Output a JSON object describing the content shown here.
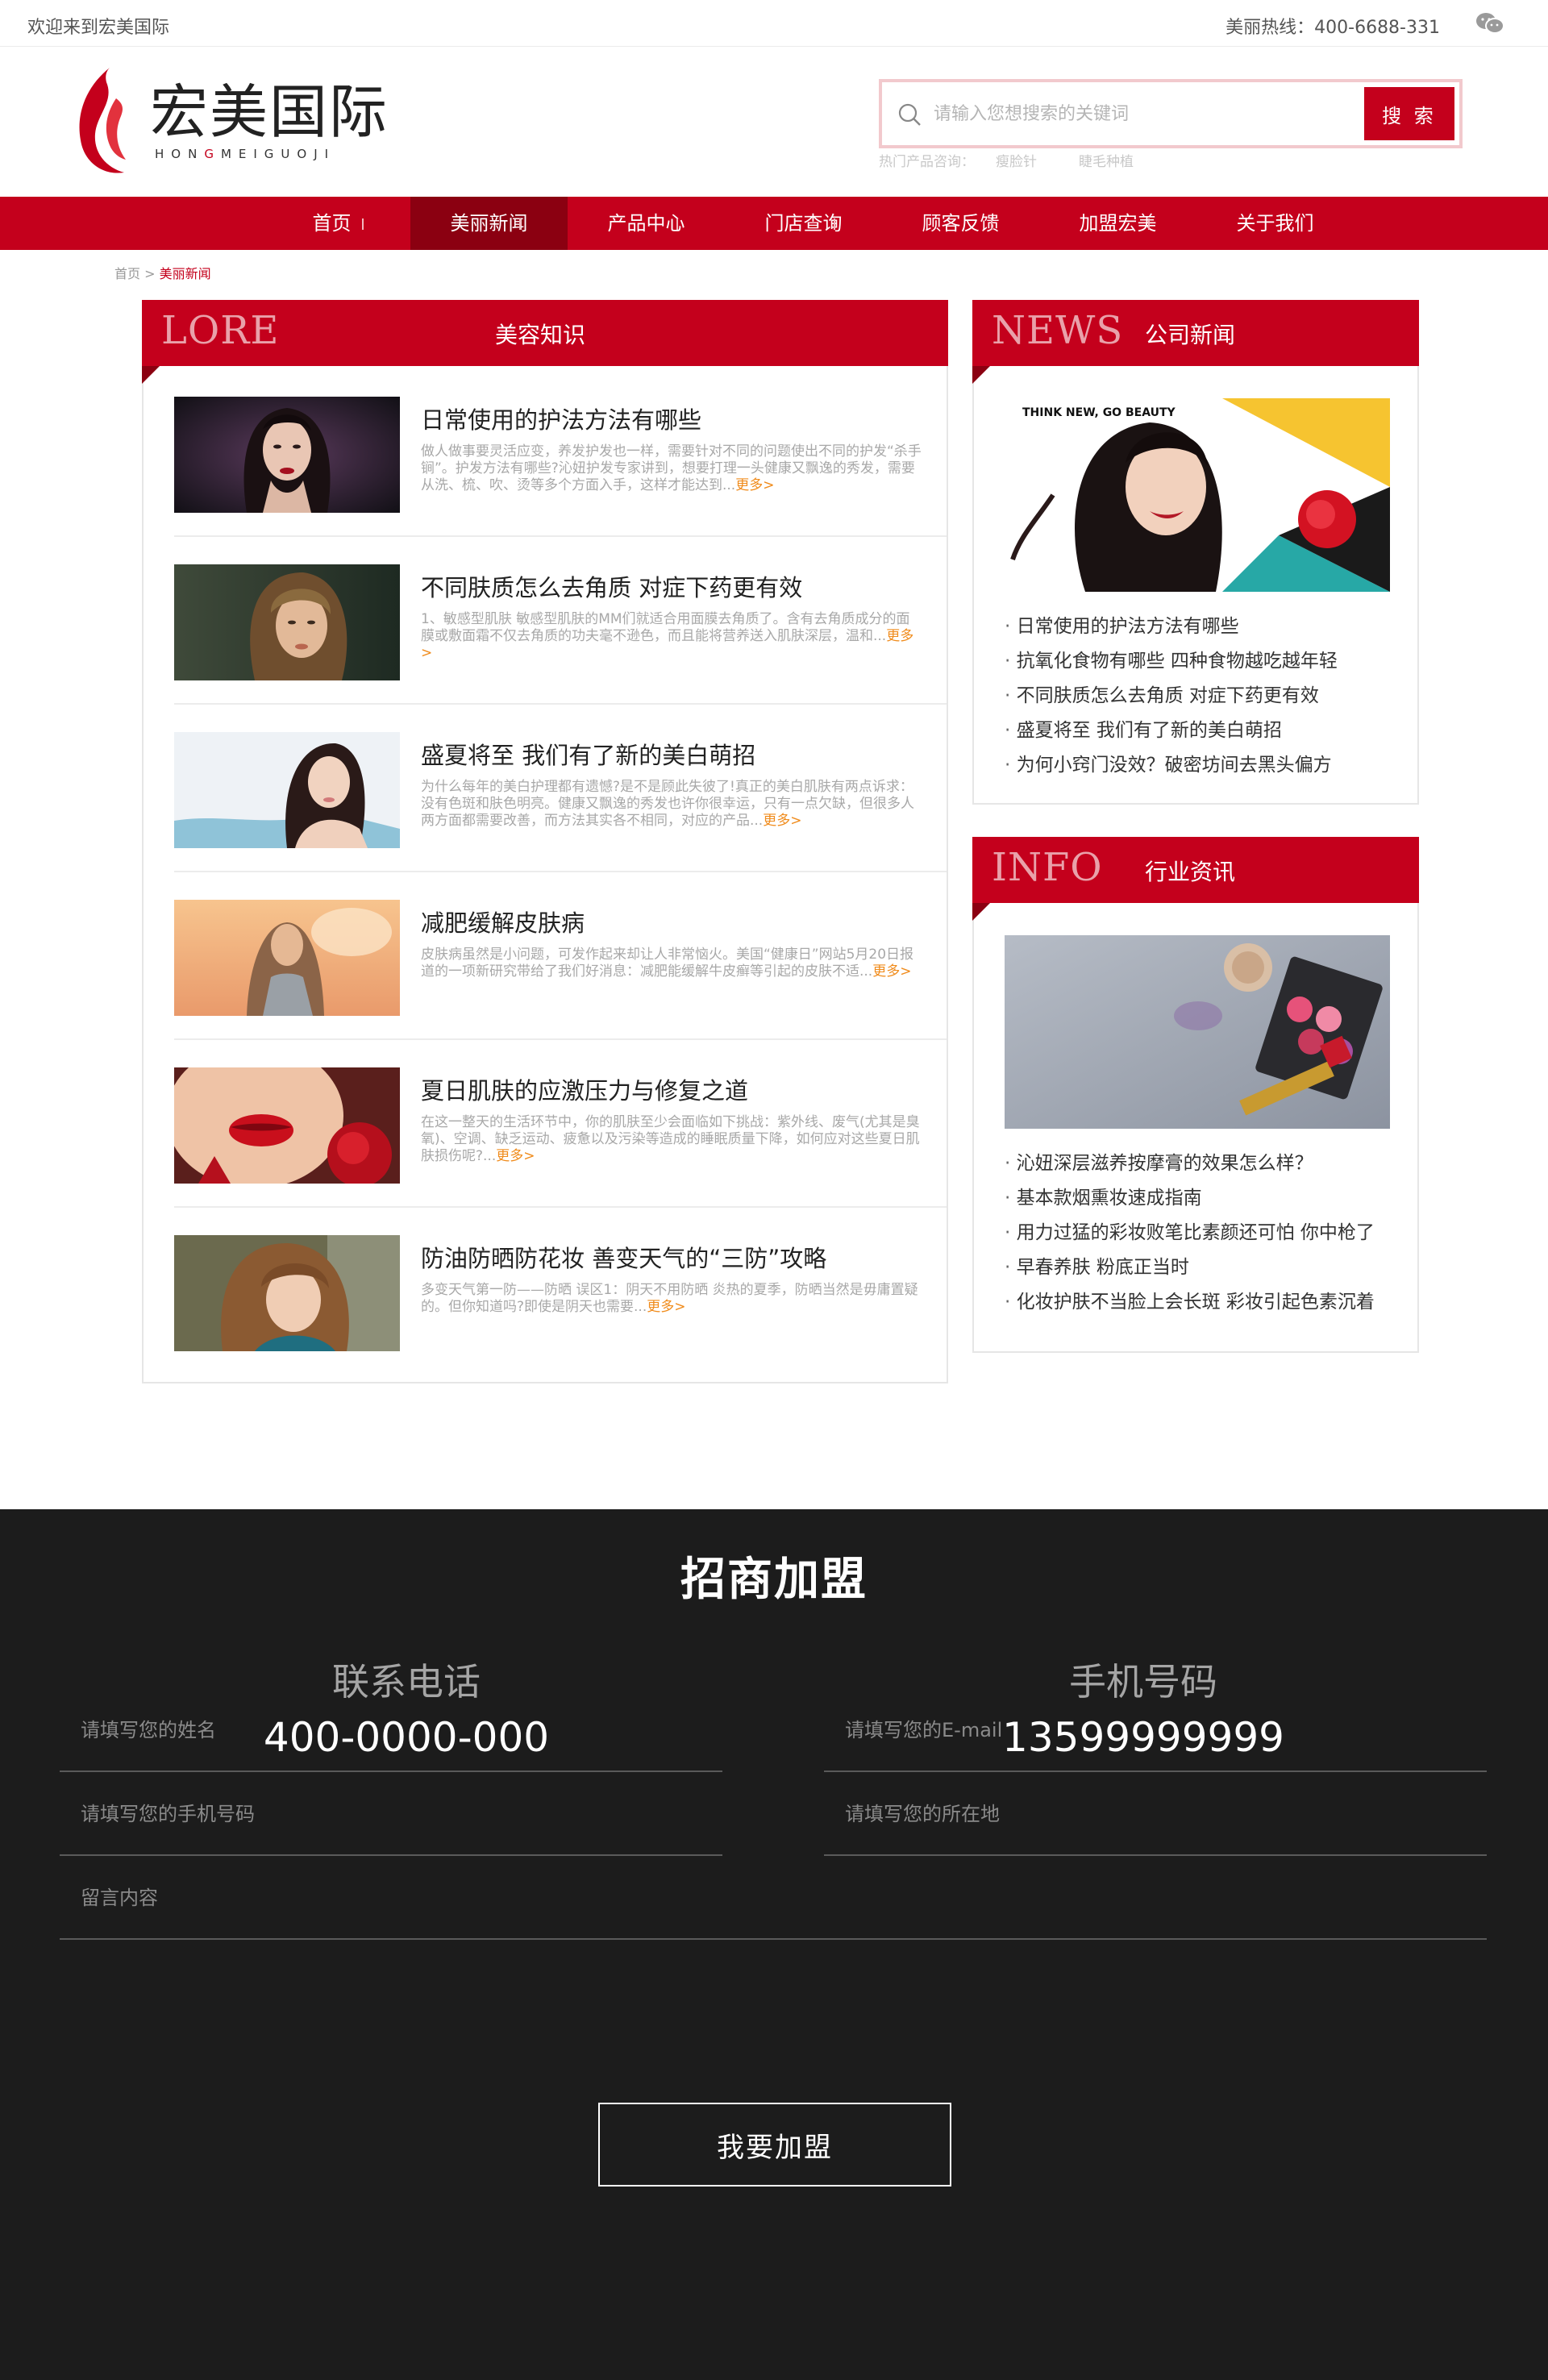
{
  "topbar": {
    "welcome": "欢迎来到宏美国际",
    "hotline": "美丽热线：400-6688-331",
    "wechat_icon": "wechat-icon"
  },
  "logo": {
    "name": "宏美国际",
    "pinyin_a": "HON",
    "pinyin_g": "G",
    "pinyin_b": "MEIGUOJI"
  },
  "search": {
    "placeholder": "请输入您想搜索的关键词",
    "button": "搜 索",
    "hot_label": "热门产品咨询：",
    "hot_items": [
      "瘦脸针",
      "睫毛种植"
    ]
  },
  "nav": {
    "items": [
      "首页",
      "美丽新闻",
      "产品中心",
      "门店查询",
      "顾客反馈",
      "加盟宏美",
      "关于我们"
    ],
    "active_index": 1
  },
  "breadcrumb": {
    "home": "首页",
    "sep": " > ",
    "current": "美丽新闻"
  },
  "lore": {
    "en": "LORE",
    "cn": "美容知识",
    "more": "更多>",
    "articles": [
      {
        "title": "日常使用的护法方法有哪些",
        "desc": "做人做事要灵活应变，养发护发也一样，需要针对不同的问题使出不同的护发“杀手锏”。护发方法有哪些?沁妞护发专家讲到，想要打理一头健康又飘逸的秀发，需要从洗、梳、吹、烫等多个方面入手，这样才能达到..."
      },
      {
        "title": "不同肤质怎么去角质 对症下药更有效",
        "desc": "1、敏感型肌肤 敏感型肌肤的MM们就适合用面膜去角质了。含有去角质成分的面膜或敷面霜不仅去角质的功夫毫不逊色，而且能将营养送入肌肤深层，温和..."
      },
      {
        "title": "盛夏将至 我们有了新的美白萌招",
        "desc": "为什么每年的美白护理都有遗憾?是不是顾此失彼了!真正的美白肌肤有两点诉求：没有色斑和肤色明亮。健康又飘逸的秀发也许你很幸运，只有一点欠缺，但很多人两方面都需要改善，而方法其实各不相同，对应的产品..."
      },
      {
        "title": "减肥缓解皮肤病",
        "desc": "皮肤病虽然是小问题，可发作起来却让人非常恼火。美国“健康日”网站5月20日报道的一项新研究带给了我们好消息：减肥能缓解牛皮癣等引起的皮肤不适..."
      },
      {
        "title": "夏日肌肤的应激压力与修复之道",
        "desc": "在这一整天的生活环节中，你的肌肤至少会面临如下挑战：紫外线、废气(尤其是臭氧)、空调、缺乏运动、疲惫以及污染等造成的睡眠质量下降，如何应对这些夏日肌肤损伤呢?..."
      },
      {
        "title": "防油防晒防花妆 善变天气的“三防”攻略",
        "desc": "多变天气第一防——防晒 误区1：阴天不用防晒 炎热的夏季，防晒当然是毋庸置疑的。但你知道吗?即使是阴天也需要..."
      }
    ]
  },
  "news": {
    "en": "NEWS",
    "cn": "公司新闻",
    "image_text": "THINK NEW, GO BEAUTY",
    "items": [
      "日常使用的护法方法有哪些",
      "抗氧化食物有哪些 四种食物越吃越年轻",
      "不同肤质怎么去角质 对症下药更有效",
      "盛夏将至 我们有了新的美白萌招",
      "为何小窍门没效？破密坊间去黑头偏方"
    ]
  },
  "info": {
    "en": "INFO",
    "cn": "行业资讯",
    "items": [
      "沁妞深层滋养按摩膏的效果怎么样？",
      "基本款烟熏妆速成指南",
      "用力过猛的彩妆败笔比素颜还可怕 你中枪了",
      "早春养肤 粉底正当时",
      "化妆护肤不当脸上会长斑 彩妆引起色素沉着"
    ]
  },
  "footer": {
    "title": "招商加盟",
    "phone_label": "联系电话",
    "phone_value": "400-0000-000",
    "mobile_label": "手机号码",
    "mobile_value": "13599999999",
    "name_placeholder": "请填写您的姓名",
    "email_placeholder": "请填写您的E-mail",
    "mobile_placeholder": "请填写您的手机号码",
    "location_placeholder": "请填写您的所在地",
    "message_placeholder": "留言内容",
    "submit": "我要加盟"
  },
  "colors": {
    "brand_red": "#c4001c",
    "nav_active": "#8b0011",
    "footer_bg": "#1c1c1c",
    "more_orange": "#f08b1b"
  }
}
